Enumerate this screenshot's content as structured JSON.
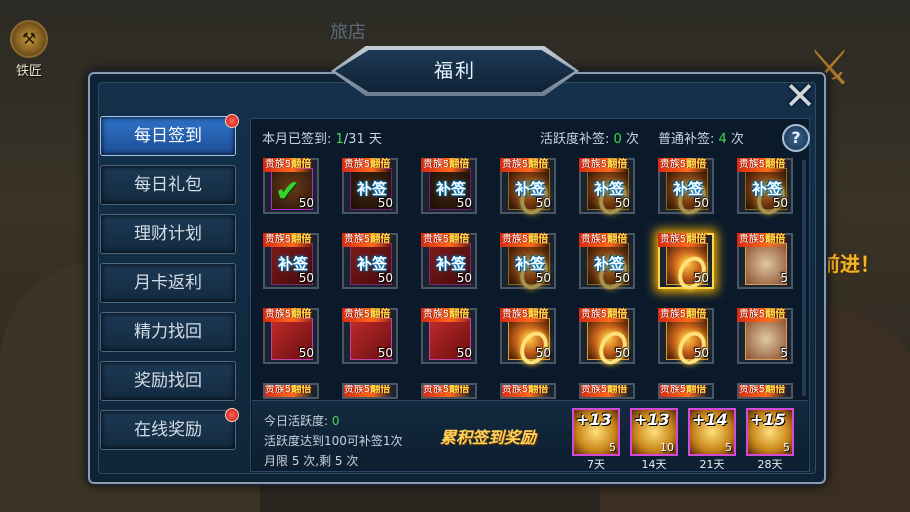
{
  "background": {
    "smith_label": "铁匠",
    "go_text": "前进！",
    "sign_text": "旅店"
  },
  "dialog": {
    "title": "福利",
    "close_icon": "close-x-icon"
  },
  "menu": {
    "items": [
      {
        "label": "每日签到",
        "active": true,
        "badge": true
      },
      {
        "label": "每日礼包",
        "active": false,
        "badge": false
      },
      {
        "label": "理财计划",
        "active": false,
        "badge": false
      },
      {
        "label": "月卡返利",
        "active": false,
        "badge": false
      },
      {
        "label": "精力找回",
        "active": false,
        "badge": false
      },
      {
        "label": "奖励找回",
        "active": false,
        "badge": false
      },
      {
        "label": "在线奖励",
        "active": false,
        "badge": true
      }
    ]
  },
  "stats": {
    "signed_label": "本月已签到: ",
    "signed_value": "1",
    "signed_total": "/31 天",
    "active_makeup_label": "活跃度补签: ",
    "active_makeup_value": "0",
    "active_makeup_unit": " 次",
    "normal_makeup_label": "普通补签: ",
    "normal_makeup_value": "4",
    "normal_makeup_unit": " 次",
    "help_label": "?"
  },
  "grid": {
    "ribbon_prefix": "贵族5",
    "ribbon_suffix": "翻倍",
    "makeup_label": "补签",
    "rows": [
      [
        {
          "type": "item",
          "qty": "50",
          "state": "signed",
          "ribbon": true
        },
        {
          "type": "item",
          "qty": "50",
          "state": "makeup",
          "ribbon": true
        },
        {
          "type": "item",
          "qty": "50",
          "state": "makeup",
          "ribbon": true
        },
        {
          "type": "gold",
          "qty": "50",
          "state": "makeup",
          "ribbon": true
        },
        {
          "type": "gold",
          "qty": "50",
          "state": "makeup",
          "ribbon": true
        },
        {
          "type": "gold",
          "qty": "50",
          "state": "makeup",
          "ribbon": true
        },
        {
          "type": "gold",
          "qty": "50",
          "state": "makeup",
          "ribbon": true
        }
      ],
      [
        {
          "type": "redbook",
          "qty": "50",
          "state": "makeup",
          "ribbon": true
        },
        {
          "type": "redbook",
          "qty": "50",
          "state": "makeup",
          "ribbon": true
        },
        {
          "type": "redbook",
          "qty": "50",
          "state": "makeup",
          "ribbon": true
        },
        {
          "type": "gold",
          "qty": "50",
          "state": "makeup",
          "ribbon": true
        },
        {
          "type": "gold",
          "qty": "50",
          "state": "makeup",
          "ribbon": true
        },
        {
          "type": "gold",
          "qty": "50",
          "state": "today",
          "ribbon": true
        },
        {
          "type": "scroll",
          "qty": "5",
          "state": "normal",
          "ribbon": true
        }
      ],
      [
        {
          "type": "redbook",
          "qty": "50",
          "state": "normal",
          "ribbon": true
        },
        {
          "type": "redbook",
          "qty": "50",
          "state": "normal",
          "ribbon": true
        },
        {
          "type": "redbook",
          "qty": "50",
          "state": "normal",
          "ribbon": true
        },
        {
          "type": "gold",
          "qty": "50",
          "state": "normal",
          "ribbon": true
        },
        {
          "type": "gold",
          "qty": "50",
          "state": "normal",
          "ribbon": true
        },
        {
          "type": "gold",
          "qty": "50",
          "state": "normal",
          "ribbon": true
        },
        {
          "type": "scroll",
          "qty": "5",
          "state": "normal",
          "ribbon": true
        }
      ]
    ]
  },
  "bottom": {
    "today_active_label": "今日活跃度: ",
    "today_active_value": "0",
    "rule_text": "活跃度达到100可补签1次",
    "limit_text": "月限 5 次,剩 5 次",
    "cumulative_title": "累积签到奖励",
    "rewards": [
      {
        "badge": "+13",
        "qty": "5",
        "day": "7天"
      },
      {
        "badge": "+13",
        "qty": "10",
        "day": "14天"
      },
      {
        "badge": "+14",
        "qty": "5",
        "day": "21天"
      },
      {
        "badge": "+15",
        "qty": "5",
        "day": "28天"
      }
    ]
  },
  "colors": {
    "accent_green": "#3fdc48",
    "active_tab": "#2f73c9",
    "gold_text": "#ffd25a"
  }
}
